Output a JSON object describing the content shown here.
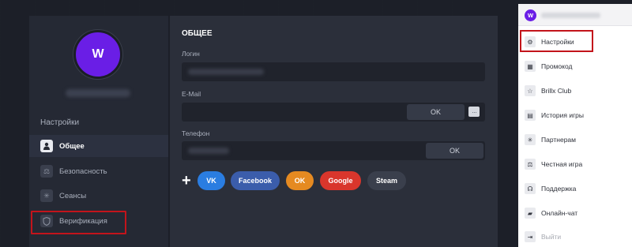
{
  "profile": {
    "avatar_letter": "W",
    "avatar_color": "#6a1ee6"
  },
  "sidebar": {
    "section_title": "Настройки",
    "items": [
      {
        "label": "Общее",
        "icon": "user-icon",
        "active": true
      },
      {
        "label": "Безопасность",
        "icon": "scales-icon",
        "active": false
      },
      {
        "label": "Сеансы",
        "icon": "sessions-icon",
        "active": false
      },
      {
        "label": "Верификация",
        "icon": "shield-icon",
        "active": false
      }
    ]
  },
  "main": {
    "title": "ОБЩЕЕ",
    "login_label": "Логин",
    "email_label": "E-Mail",
    "email_ok": "OK",
    "email_more": "···",
    "phone_label": "Телефон",
    "phone_ok": "OK",
    "plus": "+",
    "social": [
      {
        "label": "VK",
        "color": "#2a7de1"
      },
      {
        "label": "Facebook",
        "color": "#3b5dab"
      },
      {
        "label": "OK",
        "color": "#e58a21"
      },
      {
        "label": "Google",
        "color": "#d9362c"
      },
      {
        "label": "Steam",
        "color": "#3a3f4c"
      }
    ]
  },
  "dropdown": {
    "avatar_letter": "W",
    "items": [
      {
        "label": "Настройки",
        "icon": "gear-icon"
      },
      {
        "label": "Промокод",
        "icon": "promo-icon"
      },
      {
        "label": "Brillx Club",
        "icon": "star-icon"
      },
      {
        "label": "История игры",
        "icon": "history-icon"
      },
      {
        "label": "Партнерам",
        "icon": "partners-icon"
      },
      {
        "label": "Честная игра",
        "icon": "scales-icon"
      },
      {
        "label": "Поддержка",
        "icon": "headset-icon"
      },
      {
        "label": "Онлайн-чат",
        "icon": "chat-icon"
      },
      {
        "label": "Выйти",
        "icon": "logout-icon"
      }
    ]
  }
}
